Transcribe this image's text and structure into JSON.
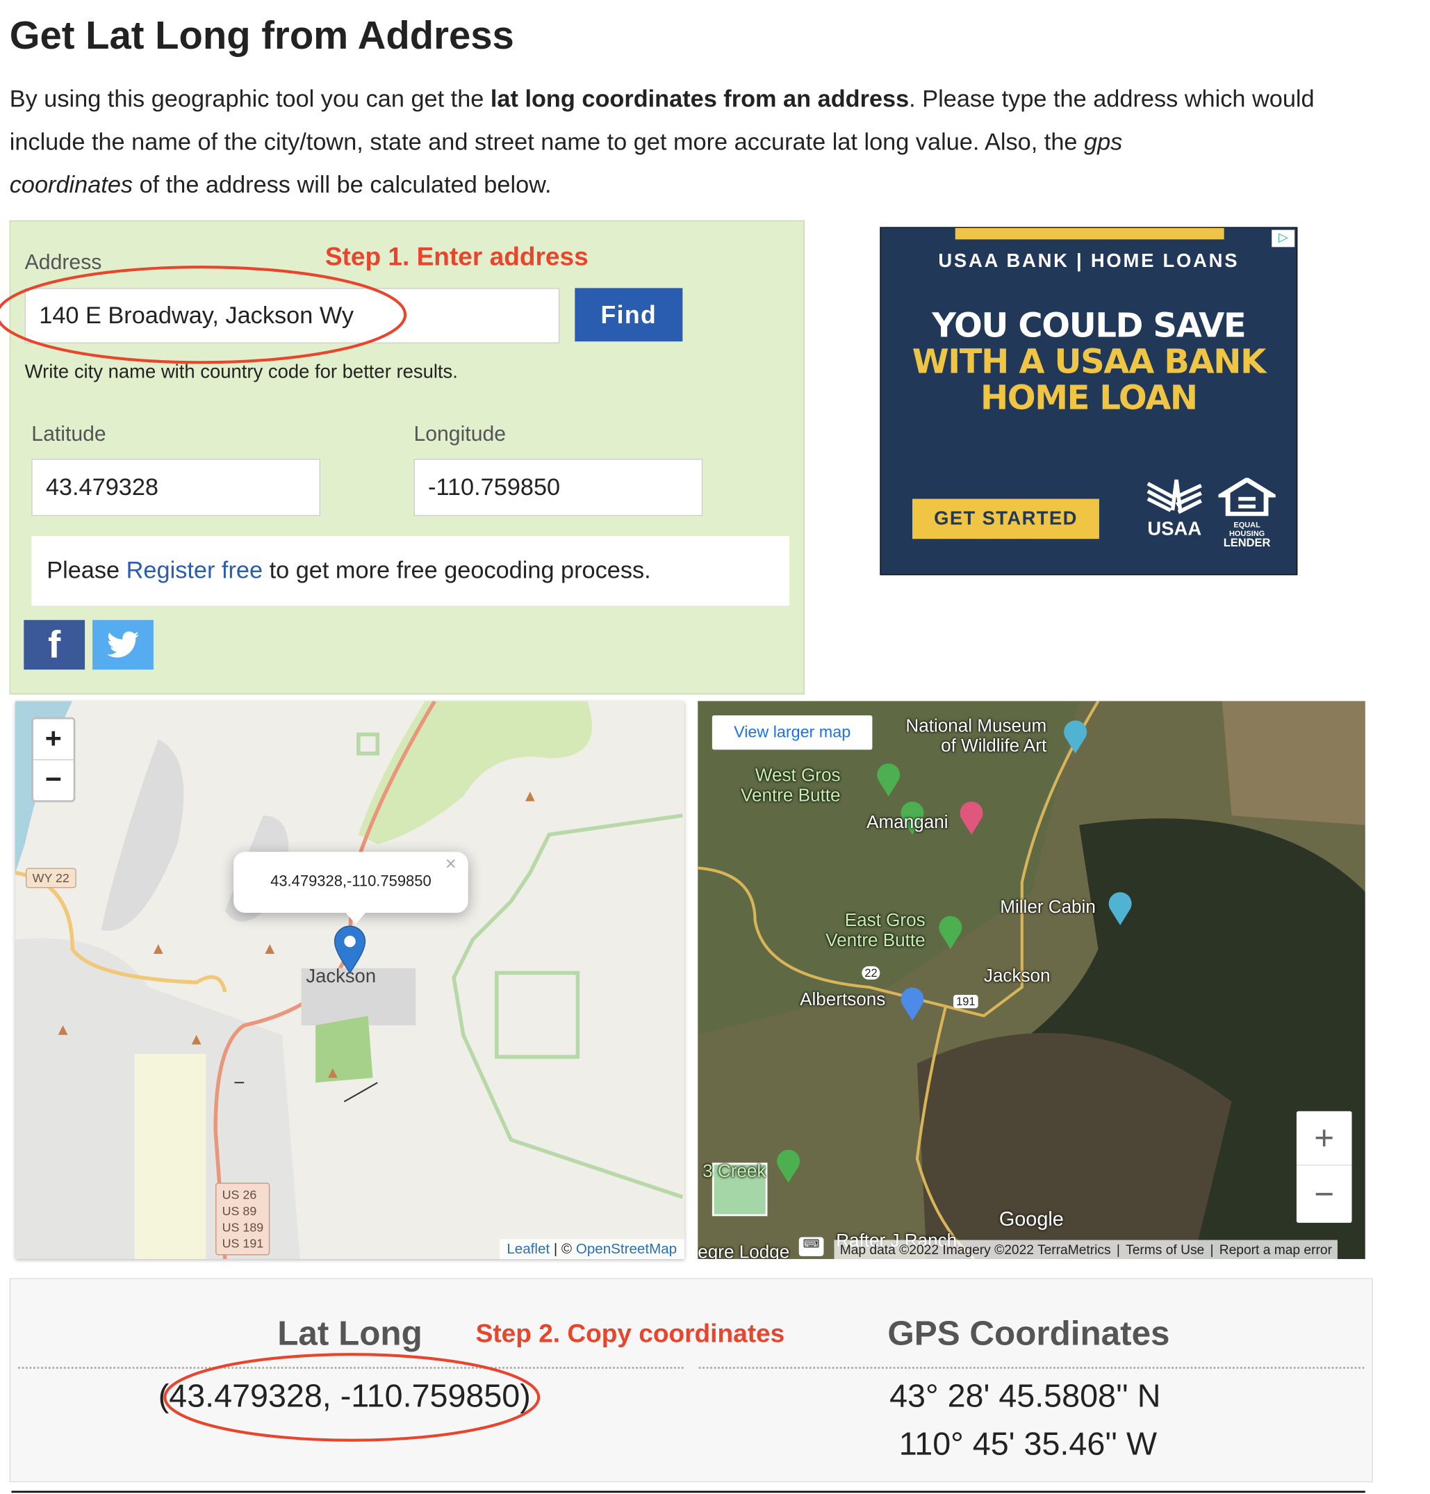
{
  "page": {
    "title": "Get Lat Long from Address",
    "intro": {
      "part1": "By using this geographic tool you can get the ",
      "bold": "lat long coordinates from an address",
      "part2": ". Please type the address which would include the name of the city/town, state and street name to get more accurate lat long value. Also, the ",
      "italic1": "gps",
      "italic2": "coordinates",
      "part3": " of the address will be calculated below."
    }
  },
  "form": {
    "address_label": "Address",
    "step1": "Step 1. Enter address",
    "address_value": "140 E Broadway, Jackson Wy",
    "find_label": "Find",
    "hint": "Write city name with country code for better results.",
    "latitude_label": "Latitude",
    "latitude_value": "43.479328",
    "longitude_label": "Longitude",
    "longitude_value": "-110.759850",
    "register": {
      "pre": "Please ",
      "link": "Register free",
      "post": " to get more free geocoding process."
    },
    "social": [
      "facebook-icon",
      "twitter-icon"
    ]
  },
  "ad": {
    "brand": "USAA BANK | HOME LOANS",
    "line1": "YOU COULD SAVE",
    "line2": "WITH A USAA BANK",
    "line3": "HOME LOAN",
    "cta": "GET STARTED",
    "logo": "USAA",
    "ehl1": "EQUAL HOUSING",
    "ehl2": "LENDER",
    "colors": {
      "bg": "#213858",
      "accent": "#efc543"
    }
  },
  "osm_map": {
    "zoom_in": "+",
    "zoom_out": "−",
    "popup": "43.479328,-110.759850",
    "popup_close": "×",
    "labels": {
      "wy22": "WY 22",
      "town": "Jackson",
      "us": [
        "US 26",
        "US 89",
        "US 189",
        "US 191"
      ]
    },
    "attribution": {
      "leaflet": "Leaflet",
      "sep": " | © ",
      "osm": "OpenStreetMap"
    }
  },
  "google_map": {
    "view_larger": "View larger map",
    "places": [
      "National Museum",
      "of Wildlife Art",
      "West Gros",
      "Ventre Butte",
      "Amangani",
      "Miller Cabin",
      "East Gros",
      "Ventre Butte",
      "Albertsons",
      "Jackson",
      "3 Creek",
      "Rafter J Ranch",
      "egre Lodge"
    ],
    "shields": [
      "22",
      "191"
    ],
    "logo": "Google",
    "footer": {
      "data": "Map data ©2022 Imagery ©2022 TerraMetrics",
      "terms": "Terms of Use",
      "report": "Report a map error"
    },
    "zoom_in": "+",
    "zoom_out": "−"
  },
  "results": {
    "latlong_title": "Lat Long",
    "step2": "Step 2. Copy coordinates",
    "gps_title": "GPS Coordinates",
    "latlong_value": "(43.479328, -110.759850)",
    "gps_lat": "43° 28' 45.5808'' N",
    "gps_lon": "110° 45' 35.46'' W"
  }
}
